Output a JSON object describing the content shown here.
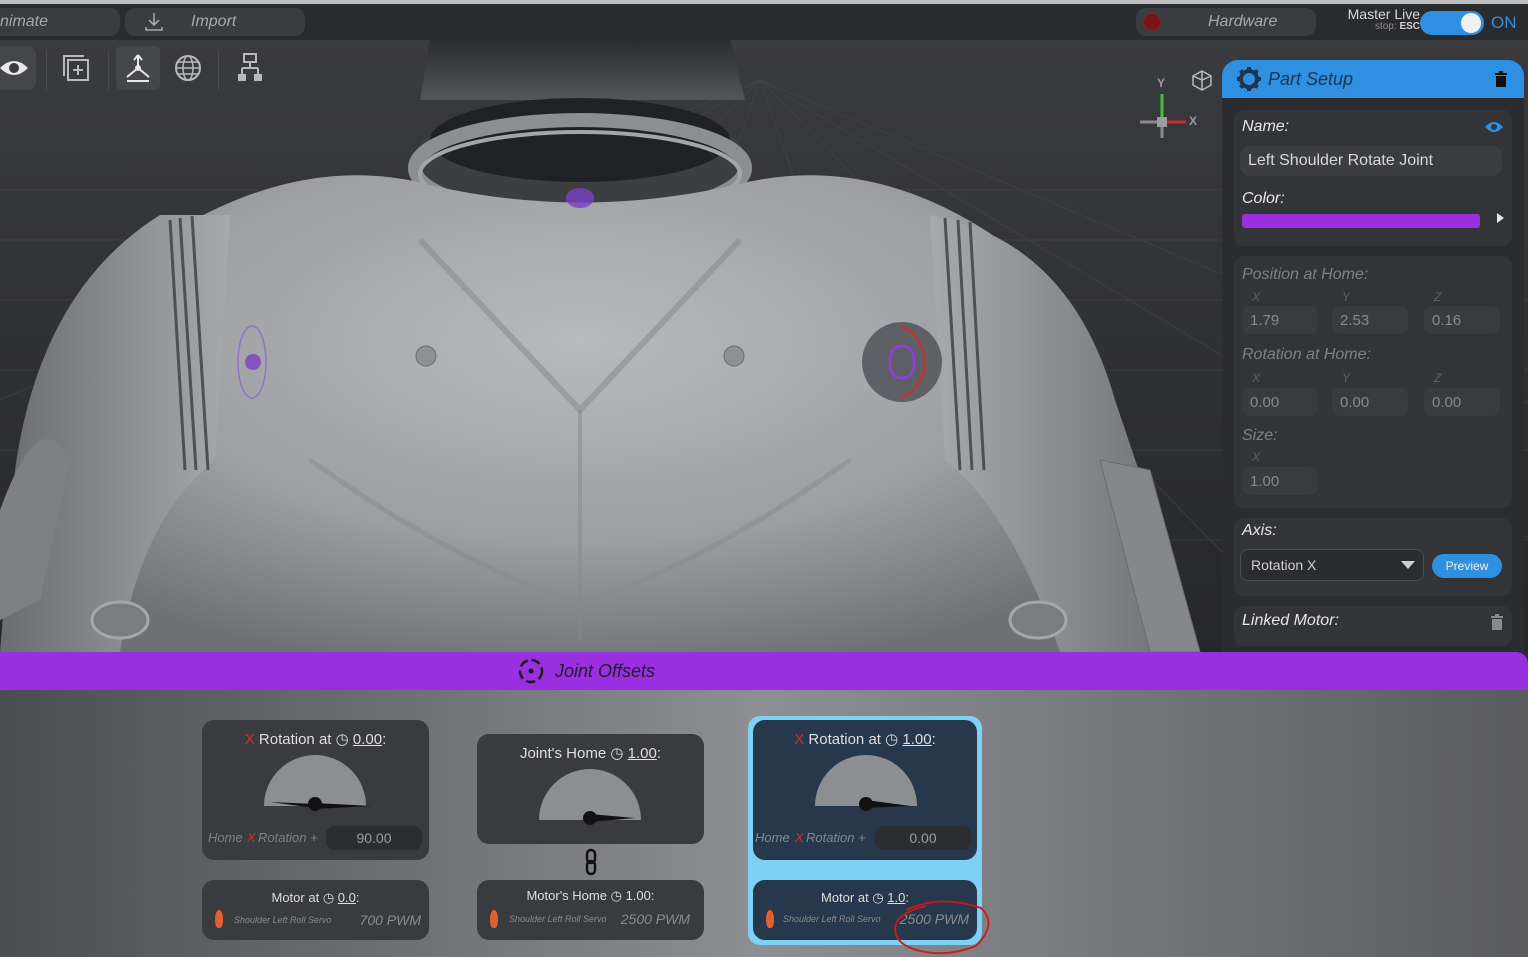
{
  "topbar": {
    "animate_label": "nimate",
    "import_label": "Import",
    "hardware_label": "Hardware",
    "master_live_label": "Master Live",
    "stop_label": "stop:",
    "stop_key": "ESC",
    "toggle_state": "ON"
  },
  "gizmo": {
    "y": "Y",
    "x": "X"
  },
  "part_setup": {
    "title": "Part Setup",
    "name_label": "Name:",
    "name_value": "Left Shoulder Rotate Joint",
    "color_label": "Color:",
    "color_value": "#9a2fe0",
    "position_label": "Position at Home:",
    "position": {
      "x": "1.79",
      "y": "2.53",
      "z": "0.16"
    },
    "rotation_label": "Rotation at Home:",
    "rotation": {
      "x": "0.00",
      "y": "0.00",
      "z": "0.00"
    },
    "size_label": "Size:",
    "size": {
      "x": "1.00"
    },
    "axis_letters": {
      "x": "X",
      "y": "Y",
      "z": "Z"
    },
    "axis_label": "Axis:",
    "axis_value": "Rotation X",
    "preview_label": "Preview",
    "linked_motor_label": "Linked Motor:"
  },
  "joint_offsets": {
    "title": "Joint Offsets",
    "cards": [
      {
        "axis": "X",
        "title": "Rotation at",
        "value": "0.00",
        "home_label": "Home",
        "rotation_label": "Rotation +",
        "offset": "90.00",
        "motor_label": "Motor at",
        "motor_value": "0.0",
        "servo": "Shoulder Left Roll Servo",
        "pwm": "700 PWM"
      },
      {
        "title": "Joint's Home",
        "value": "1.00",
        "motor_label": "Motor's Home",
        "motor_value": "1.00",
        "servo": "Shoulder Left Roll Servo",
        "pwm": "2500 PWM"
      },
      {
        "axis": "X",
        "title": "Rotation at",
        "value": "1.00",
        "home_label": "Home",
        "rotation_label": "Rotation +",
        "offset": "0.00",
        "motor_label": "Motor at",
        "motor_value": "1.0",
        "servo": "Shoulder Left Roll Servo",
        "pwm": "2500 PWM"
      }
    ]
  },
  "colors": {
    "accent_blue": "#2f8fe0",
    "accent_purple": "#9a2fe0",
    "selected_card": "#7fd0f5",
    "axis_x": "#c83434",
    "servo_orange": "#e0602f"
  }
}
